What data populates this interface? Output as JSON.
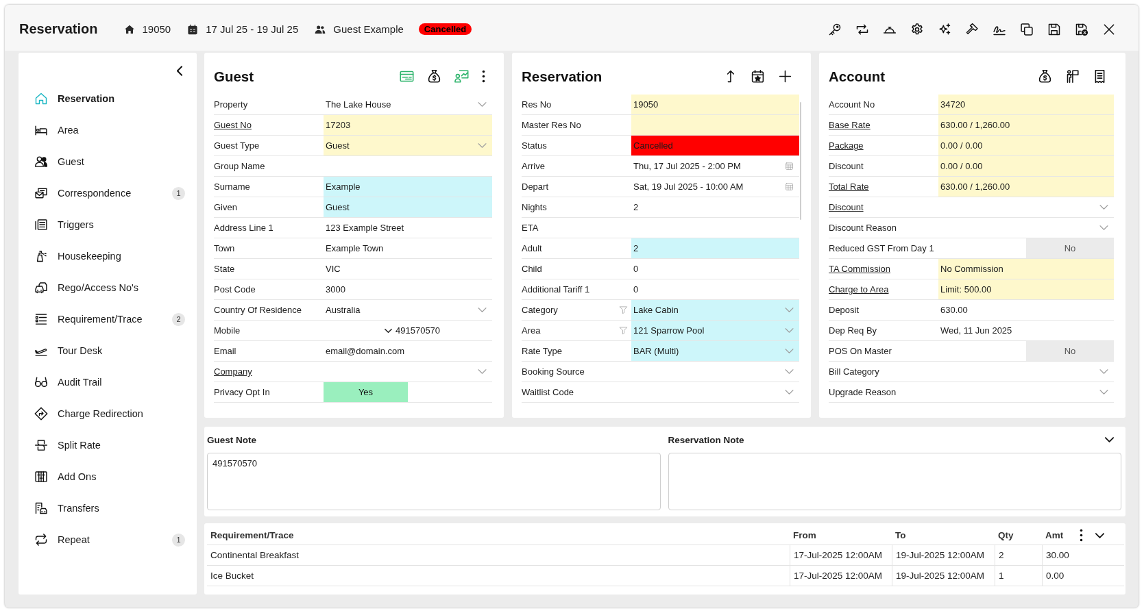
{
  "header": {
    "title": "Reservation",
    "res_no": "19050",
    "dates": "17 Jul 25 - 19 Jul 25",
    "guest": "Guest Example",
    "status": "Cancelled"
  },
  "sidebar": {
    "items": [
      {
        "label": "Reservation",
        "selected": true
      },
      {
        "label": "Area",
        "selected": false
      },
      {
        "label": "Guest",
        "selected": false
      },
      {
        "label": "Correspondence",
        "selected": false,
        "badge": "1"
      },
      {
        "label": "Triggers",
        "selected": false
      },
      {
        "label": "Housekeeping",
        "selected": false
      },
      {
        "label": "Rego/Access No's",
        "selected": false
      },
      {
        "label": "Requirement/Trace",
        "selected": false,
        "badge": "2"
      },
      {
        "label": "Tour Desk",
        "selected": false
      },
      {
        "label": "Audit Trail",
        "selected": false
      },
      {
        "label": "Charge Redirection",
        "selected": false
      },
      {
        "label": "Split Rate",
        "selected": false
      },
      {
        "label": "Add Ons",
        "selected": false
      },
      {
        "label": "Transfers",
        "selected": false
      },
      {
        "label": "Repeat",
        "selected": false,
        "badge": "1"
      }
    ]
  },
  "panels": [
    {
      "title": "Guest",
      "rows": [
        {
          "kind": "dropdown",
          "label": "Property",
          "link": false,
          "value": "The Lake House"
        },
        {
          "kind": "text",
          "label": "Guest No",
          "link": true,
          "value": "17203",
          "color": "#fef8cc"
        },
        {
          "kind": "dropdown",
          "label": "Guest Type",
          "link": false,
          "value": "Guest",
          "color": "#fef8cc"
        },
        {
          "kind": "text",
          "label": "Group Name",
          "link": false
        },
        {
          "kind": "text",
          "label": "Surname",
          "link": false,
          "value": "Example",
          "color": "#cdf6fa"
        },
        {
          "kind": "text",
          "label": "Given",
          "link": false,
          "value": "Guest",
          "color": "#cdf6fa"
        },
        {
          "kind": "text",
          "label": "Address Line 1",
          "link": false,
          "value": "123 Example Street"
        },
        {
          "kind": "text",
          "label": "Town",
          "link": false,
          "value": "Example Town"
        },
        {
          "kind": "text",
          "label": "State",
          "link": false,
          "value": "VIC"
        },
        {
          "kind": "text",
          "label": "Post Code",
          "link": false,
          "value": "3000"
        },
        {
          "kind": "dropdown",
          "label": "Country Of Residence",
          "link": false,
          "value": "Australia"
        },
        {
          "kind": "phone",
          "label": "Mobile",
          "link": false,
          "value": "491570570"
        },
        {
          "kind": "text",
          "label": "Email",
          "link": false,
          "value": "email@domain.com"
        },
        {
          "kind": "dropdown",
          "label": "Company",
          "link": true
        },
        {
          "kind": "toggle",
          "label": "Privacy Opt In",
          "link": false,
          "on": true,
          "value": "Yes"
        }
      ]
    },
    {
      "title": "Reservation",
      "rows": [
        {
          "kind": "text",
          "label": "Res No",
          "link": false,
          "value": "19050",
          "color": "#fef8cc"
        },
        {
          "kind": "text",
          "label": "Master Res No",
          "link": false,
          "color": "#fef8cc"
        },
        {
          "kind": "text",
          "label": "Status",
          "link": false,
          "value": "Cancelled",
          "color": "#ff0000"
        },
        {
          "kind": "date",
          "label": "Arrive",
          "link": false,
          "value": "Thu, 17 Jul 2025 - 2:00 PM"
        },
        {
          "kind": "date",
          "label": "Depart",
          "link": false,
          "value": "Sat, 19 Jul 2025 - 10:00 AM"
        },
        {
          "kind": "text",
          "label": "Nights",
          "link": false,
          "value": "2"
        },
        {
          "kind": "text",
          "label": "ETA",
          "link": false
        },
        {
          "kind": "text",
          "label": "Adult",
          "link": false,
          "value": "2",
          "color": "#cdf6fa"
        },
        {
          "kind": "text",
          "label": "Child",
          "link": false,
          "value": "0"
        },
        {
          "kind": "text",
          "label": "Additional Tariff 1",
          "link": false,
          "value": "0"
        },
        {
          "kind": "filter_dropdown",
          "label": "Category",
          "link": false,
          "value": "Lake Cabin",
          "color": "#cdf6fa"
        },
        {
          "kind": "filter_dropdown",
          "label": "Area",
          "link": false,
          "value": "121 Sparrow Pool",
          "color": "#cdf6fa"
        },
        {
          "kind": "dropdown",
          "label": "Rate Type",
          "link": false,
          "value": "BAR (Multi)",
          "color": "#cdf6fa"
        },
        {
          "kind": "dropdown",
          "label": "Booking Source",
          "link": false
        },
        {
          "kind": "dropdown",
          "label": "Waitlist Code",
          "link": false
        }
      ]
    },
    {
      "title": "Account",
      "rows": [
        {
          "kind": "text",
          "label": "Account No",
          "link": false,
          "value": "34720",
          "color": "#fef8cc"
        },
        {
          "kind": "text",
          "label": "Base Rate",
          "link": true,
          "value": "630.00 / 1,260.00",
          "color": "#fef8cc"
        },
        {
          "kind": "text",
          "label": "Package",
          "link": true,
          "value": "0.00 / 0.00",
          "color": "#fef8cc"
        },
        {
          "kind": "text",
          "label": "Discount",
          "link": false,
          "value": "0.00 / 0.00",
          "color": "#fef8cc"
        },
        {
          "kind": "text",
          "label": "Total Rate",
          "link": true,
          "value": "630.00 / 1,260.00",
          "color": "#fef8cc"
        },
        {
          "kind": "dropdown",
          "label": "Discount",
          "link": true
        },
        {
          "kind": "dropdown",
          "label": "Discount Reason",
          "link": false
        },
        {
          "kind": "toggle",
          "label": "Reduced GST From Day 1",
          "link": false,
          "on": false,
          "value": "No"
        },
        {
          "kind": "text",
          "label": "TA Commission",
          "link": true,
          "value": "No Commission",
          "color": "#fef8cc"
        },
        {
          "kind": "text",
          "label": "Charge to Area",
          "link": true,
          "value": "Limit: 500.00",
          "color": "#fef8cc"
        },
        {
          "kind": "text",
          "label": "Deposit",
          "link": false,
          "value": "630.00"
        },
        {
          "kind": "text",
          "label": "Dep Req By",
          "link": false,
          "value": "Wed, 11 Jun 2025"
        },
        {
          "kind": "toggle",
          "label": "POS On Master",
          "link": false,
          "on": false,
          "value": "No"
        },
        {
          "kind": "dropdown",
          "label": "Bill Category",
          "link": false
        },
        {
          "kind": "dropdown",
          "label": "Upgrade Reason",
          "link": false
        }
      ]
    }
  ],
  "notes": [
    {
      "label": "Guest Note",
      "value": "491570570"
    },
    {
      "label": "Reservation Note"
    }
  ],
  "requirements": {
    "columns": [
      "Requirement/Trace",
      "From",
      "To",
      "Qty",
      "Amt"
    ],
    "rows": [
      [
        "Continental Breakfast",
        "17-Jul-2025 12:00AM",
        "19-Jul-2025 12:00AM",
        "2",
        "30.00"
      ],
      [
        "Ice Bucket",
        "17-Jul-2025 12:00AM",
        "19-Jul-2025 12:00AM",
        "1",
        "0.00"
      ]
    ]
  }
}
